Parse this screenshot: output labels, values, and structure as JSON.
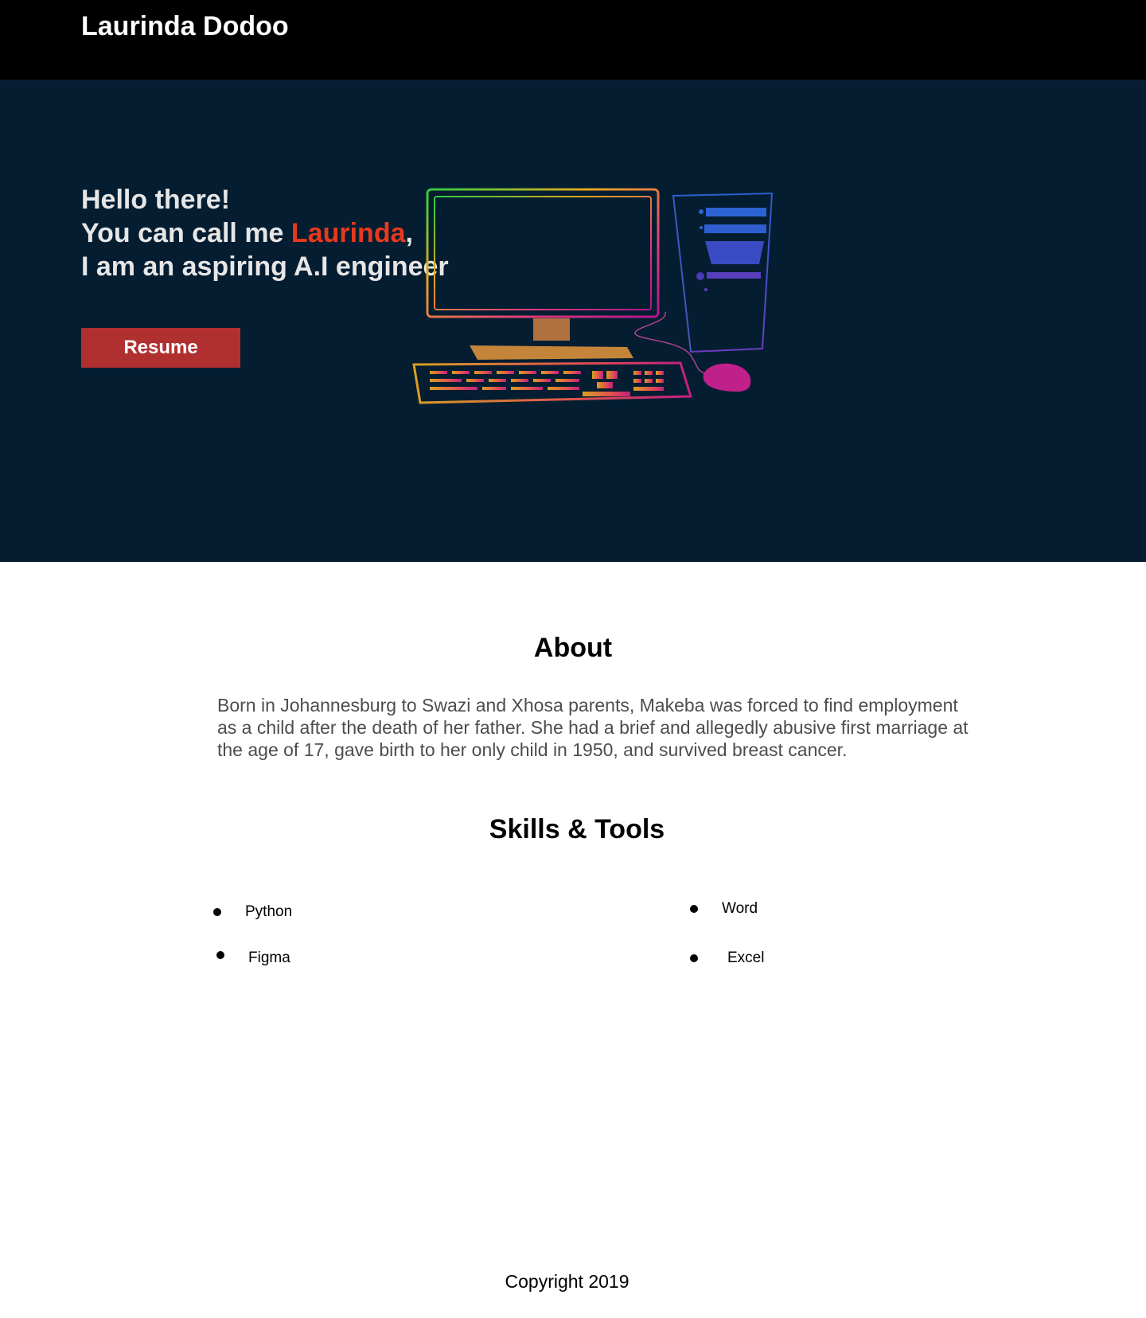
{
  "header": {
    "brand": "Laurinda Dodoo"
  },
  "hero": {
    "line1": "Hello there!",
    "line2_prefix": "You can call me ",
    "line2_name": "Laurinda",
    "line2_suffix": ",",
    "line3": "I am an aspiring A.I engineer",
    "resume_label": "Resume",
    "illustration": "computer-icon",
    "colors": {
      "background": "#051d31",
      "accent": "#e8391c",
      "button": "#b03030"
    }
  },
  "about": {
    "title": "About",
    "text": "Born in Johannesburg to Swazi and Xhosa parents, Makeba was forced to find employment as a child after the death of her father. She had a brief and allegedly abusive first marriage at the age of 17, gave birth to her only child in 1950, and survived breast cancer."
  },
  "skills": {
    "title": "Skills & Tools",
    "items": [
      "Python",
      "Word",
      "Figma",
      "Excel"
    ]
  },
  "footer": {
    "text": "Copyright 2019"
  }
}
